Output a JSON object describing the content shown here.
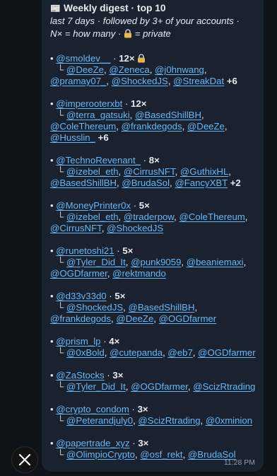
{
  "digest": {
    "emoji": "📰",
    "title": "Weekly digest · top 10",
    "subtitle1": "last 7 days · followed by 3+ of your accounts ·",
    "subtitle2a": "N× = how many · ",
    "lock_icon": "lock-icon",
    "subtitle2b": " = private",
    "timestamp": "11:28 PM",
    "bullet": "•",
    "tree_glyph": "└",
    "entries": [
      {
        "handle": "@smoldev__",
        "count": "12×",
        "private": true,
        "followers": [
          "@DeeZe",
          "@Zeneca",
          "@j0hnwang",
          "@pramay07_",
          "@ShockedJS",
          "@StreakDat"
        ],
        "more": "+6"
      },
      {
        "handle": "@imperooterxbt",
        "count": "12×",
        "private": false,
        "followers": [
          "@terra_gatsuki",
          "@BasedShillBH",
          "@ColeThereum",
          "@frankdegods",
          "@DeeZe",
          "@Husslin_"
        ],
        "more": "+6"
      },
      {
        "handle": "@TechnoRevenant_",
        "count": "8×",
        "private": false,
        "followers": [
          "@izebel_eth",
          "@CirrusNFT",
          "@GuthixHL",
          "@BasedShillBH",
          "@BrudaSol",
          "@FancyXBT"
        ],
        "more": "+2"
      },
      {
        "handle": "@MoneyPrinter0x",
        "count": "5×",
        "private": false,
        "followers": [
          "@izebel_eth",
          "@traderpow",
          "@ColeThereum",
          "@CirrusNFT",
          "@ShockedJS"
        ],
        "more": ""
      },
      {
        "handle": "@runetoshi21",
        "count": "5×",
        "private": false,
        "followers": [
          "@Tyler_Did_It",
          "@punk9059",
          "@beaniemaxi",
          "@OGDfarmer",
          "@rektmando"
        ],
        "more": ""
      },
      {
        "handle": "@d33v33d0",
        "count": "5×",
        "private": false,
        "followers": [
          "@ShockedJS",
          "@BasedShillBH",
          "@frankdegods",
          "@DeeZe",
          "@OGDfarmer"
        ],
        "more": ""
      },
      {
        "handle": "@prism_lp",
        "count": "4×",
        "private": false,
        "followers": [
          "@0xBold",
          "@cutepanda",
          "@eb7",
          "@OGDfarmer"
        ],
        "more": ""
      },
      {
        "handle": "@ZaStocks",
        "count": "3×",
        "private": false,
        "followers": [
          "@Tyler_Did_It",
          "@OGDfarmer",
          "@ScizRtrading"
        ],
        "more": ""
      },
      {
        "handle": "@crypto_condom",
        "count": "3×",
        "private": false,
        "followers": [
          "@Peterandjuly0",
          "@ScizRtrading",
          "@0xminion"
        ],
        "more": ""
      },
      {
        "handle": "@papertrade_xyz",
        "count": "3×",
        "private": false,
        "followers": [
          "@OlimpioCrypto",
          "@osf_rekt",
          "@BrudaSol"
        ],
        "more": ""
      }
    ]
  }
}
